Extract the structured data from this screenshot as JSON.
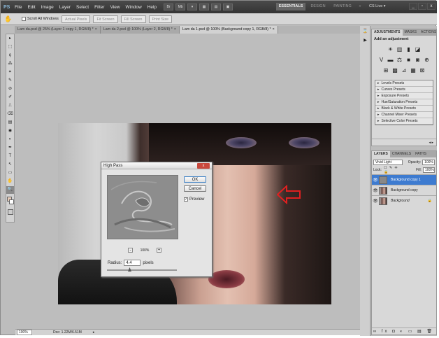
{
  "app": {
    "logo": "PS",
    "menu": [
      "File",
      "Edit",
      "Image",
      "Layer",
      "Select",
      "Filter",
      "View",
      "Window",
      "Help"
    ],
    "workspaces": {
      "essentials": "ESSENTIALS",
      "design": "DESIGN",
      "painting": "PAINTING",
      "more": "»"
    },
    "cslive": "CS Live ▾",
    "win_buttons": [
      "_",
      "▫",
      "x"
    ]
  },
  "options_bar": {
    "scroll_all": "Scroll All Windows",
    "buttons": [
      "Actual Pixels",
      "Fit Screen",
      "Fill Screen",
      "Print Size"
    ]
  },
  "tabs": [
    {
      "label": "Lam da.psd @ 25% (Layer 1 copy 1, RGB/8) *",
      "close": "×"
    },
    {
      "label": "Lam da 2.psd @ 100% (Layer 2, RGB/8) *",
      "close": "×"
    },
    {
      "label": "Lam da 1.psd @ 100% (Background copy 1, RGB/8) *",
      "close": "×"
    }
  ],
  "tools": [
    "▸",
    "⬚",
    "ϙ",
    "⁂",
    "⌗",
    "✎",
    "⊘",
    "✐",
    "⎍",
    "⌫",
    "▤",
    "◉",
    "◐",
    "✒",
    "T",
    "↖",
    "▭",
    "✋",
    "🔍"
  ],
  "dialog": {
    "title": "High Pass",
    "close": "x",
    "ok": "OK",
    "cancel": "Cancel",
    "preview_label": "Preview",
    "preview_checked": "✓",
    "zoom_minus": "-",
    "zoom_plus": "+",
    "zoom": "100%",
    "radius_label": "Radius:",
    "radius_value": "4.4",
    "radius_unit": "pixels"
  },
  "status": {
    "zoom": "100%",
    "doc": "Doc: 1.22M/6.51M",
    "arrow": "▸"
  },
  "adjustments": {
    "tabs": [
      "ADJUSTMENTS",
      "MASKS",
      "ACTIONS"
    ],
    "title": "Add an adjustment",
    "row1": [
      "☀",
      "▥",
      "▮",
      "◪"
    ],
    "row2": [
      "V",
      "▬",
      "⚖",
      "■",
      "◙",
      "⊕"
    ],
    "row3": [
      "⊞",
      "▩",
      "⊿",
      "▦",
      "⊠"
    ],
    "presets": [
      "Levels Presets",
      "Curves Presets",
      "Exposure Presets",
      "Hue/Saturation Presets",
      "Black & White Presets",
      "Channel Mixer Presets",
      "Selective Color Presets"
    ],
    "footer": "◂ ▸"
  },
  "layers": {
    "tabs": [
      "LAYERS",
      "CHANNELS",
      "PATHS"
    ],
    "blend": "Vivid Light",
    "opacity_label": "Opacity:",
    "opacity": "100%",
    "lock_label": "Lock:",
    "lock_icons": "☐ ✎ ✛ 🔒",
    "fill_label": "Fill:",
    "fill": "100%",
    "items": [
      {
        "name": "Background copy 1",
        "visible": "👁"
      },
      {
        "name": "Background copy",
        "visible": "👁"
      },
      {
        "name": "Background",
        "visible": "👁",
        "lock": "🔒"
      }
    ],
    "footer": "∞ fx ◘ ◐ ▭ ▤ 🗑"
  }
}
